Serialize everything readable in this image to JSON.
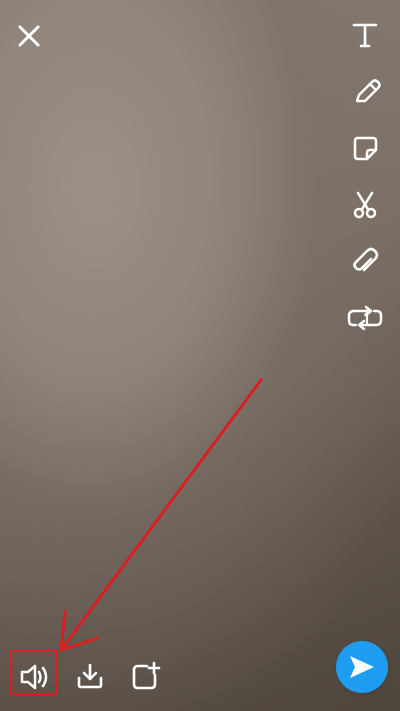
{
  "toolbar": {
    "close": {
      "label": "Close",
      "icon": "close-icon"
    },
    "tools": [
      {
        "label": "Text",
        "icon": "text-icon"
      },
      {
        "label": "Pencil",
        "icon": "pencil-icon"
      },
      {
        "label": "Sticker",
        "icon": "sticker-icon"
      },
      {
        "label": "Scissors",
        "icon": "scissors-icon"
      },
      {
        "label": "Attachment",
        "icon": "paperclip-icon"
      },
      {
        "label": "Loop",
        "icon": "loop-icon"
      }
    ]
  },
  "bottom_bar": {
    "sound": {
      "label": "Sound",
      "icon": "speaker-icon"
    },
    "download": {
      "label": "Download",
      "icon": "download-icon"
    },
    "story": {
      "label": "Add to Story",
      "icon": "add-story-icon"
    },
    "send": {
      "label": "Send",
      "icon": "send-icon"
    }
  },
  "annotation": {
    "color": "#d91f1f",
    "target": "sound-button"
  },
  "theme": {
    "background": "#7f736b",
    "icon_color": "#ffffff",
    "send_color": "#1e9df0"
  }
}
